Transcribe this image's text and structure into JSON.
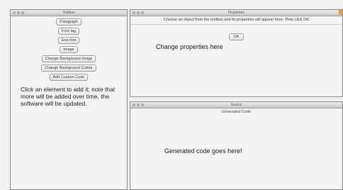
{
  "toolbox": {
    "title": "Toolbox",
    "buttons": [
      "Paragraph",
      "Font tag",
      "End font",
      "Image",
      "Change Background Image",
      "Change Background Colour",
      "Add Custom Code"
    ],
    "help_text": "Click an element to add it; note that more will be added over time, the software will be updated."
  },
  "properties": {
    "title": "Properties",
    "instructions": "Choose an object from the toolbox and its properties will appear here. Then click OK",
    "ok_label": "OK",
    "message": "Change properties here",
    "accent_color": "#f0a030"
  },
  "source": {
    "title": "Source",
    "heading": "Generated Code",
    "message": "Generated code goes here!"
  }
}
